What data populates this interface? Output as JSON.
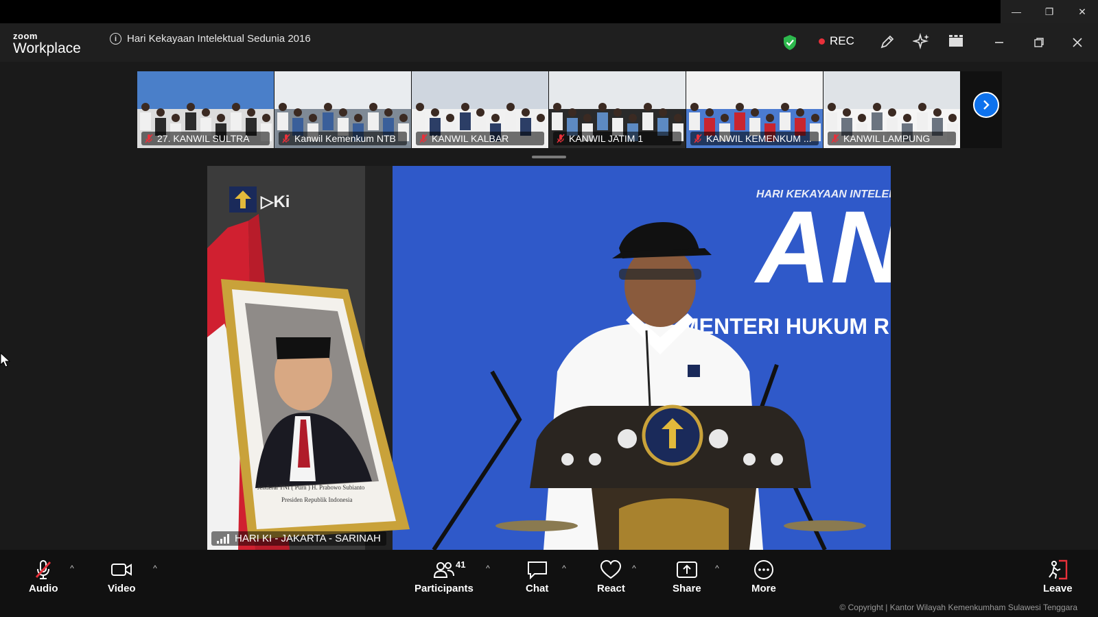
{
  "os": {
    "minimize": "—",
    "restore": "❐",
    "close": "✕"
  },
  "app": {
    "brand_top": "zoom",
    "brand_bottom": "Workplace",
    "meeting_title": "Hari Kekayaan Intelektual Sedunia 2016",
    "rec_label": "REC"
  },
  "participants_strip": [
    {
      "label": "27. KANWIL SULTRA",
      "muted": true
    },
    {
      "label": "Kanwil Kemenkum NTB",
      "muted": true
    },
    {
      "label": "KANWIL KALBAR",
      "muted": true
    },
    {
      "label": "KANWIL JATIM 1",
      "muted": true
    },
    {
      "label": "KANWIL KEMENKUM ...",
      "muted": true
    },
    {
      "label": "KANWIL LAMPUNG",
      "muted": true
    }
  ],
  "main_video": {
    "label": "HARI KI - JAKARTA - SARINAH",
    "backdrop_text": "MENTERI HUKUM R",
    "backdrop_big": "AN",
    "backdrop_small": "HARI KEKAYAAN INTELEKTUAL SEDUNIA",
    "portrait_caption_1": "Jenderal TNI ( Purn ) H. Prabowo Subianto",
    "portrait_caption_2": "Presiden Republik Indonesia"
  },
  "toolbar": {
    "audio": "Audio",
    "video": "Video",
    "participants": "Participants",
    "participants_count": "41",
    "chat": "Chat",
    "react": "React",
    "share": "Share",
    "more": "More",
    "leave": "Leave",
    "caret": "^"
  },
  "copyright": "© Copyright | Kantor Wilayah Kemenkumham Sulawesi Tenggara",
  "colors": {
    "accent": "#0e72ed",
    "rec": "#e8303a",
    "muted": "#e8303a",
    "shield": "#2db84d",
    "backdrop": "#2f59c9"
  }
}
